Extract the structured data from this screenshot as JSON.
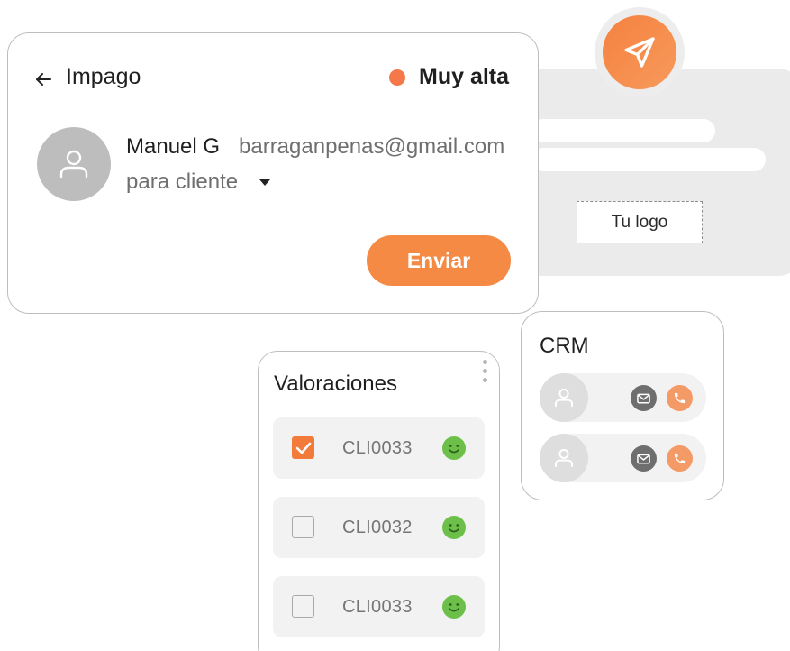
{
  "main_card": {
    "title": "Impago",
    "priority": {
      "label": "Muy alta",
      "color": "#f4784a"
    },
    "contact": {
      "name": "Manuel G",
      "email": "barraganpenas@gmail.com",
      "recipient": "para cliente"
    },
    "send_label": "Enviar",
    "accent": "#f58a45"
  },
  "preview": {
    "logo_placeholder": "Tu logo"
  },
  "crm": {
    "title": "CRM",
    "contacts": [
      {
        "icons": [
          "user-icon",
          "mail-icon",
          "phone-icon"
        ]
      },
      {
        "icons": [
          "user-icon",
          "mail-icon",
          "phone-icon"
        ]
      }
    ]
  },
  "valoraciones": {
    "title": "Valoraciones",
    "items": [
      {
        "id": "CLI0033",
        "checked": true,
        "rating": "happy"
      },
      {
        "id": "CLI0032",
        "checked": false,
        "rating": "happy"
      },
      {
        "id": "CLI0033",
        "checked": false,
        "rating": "happy"
      }
    ]
  }
}
